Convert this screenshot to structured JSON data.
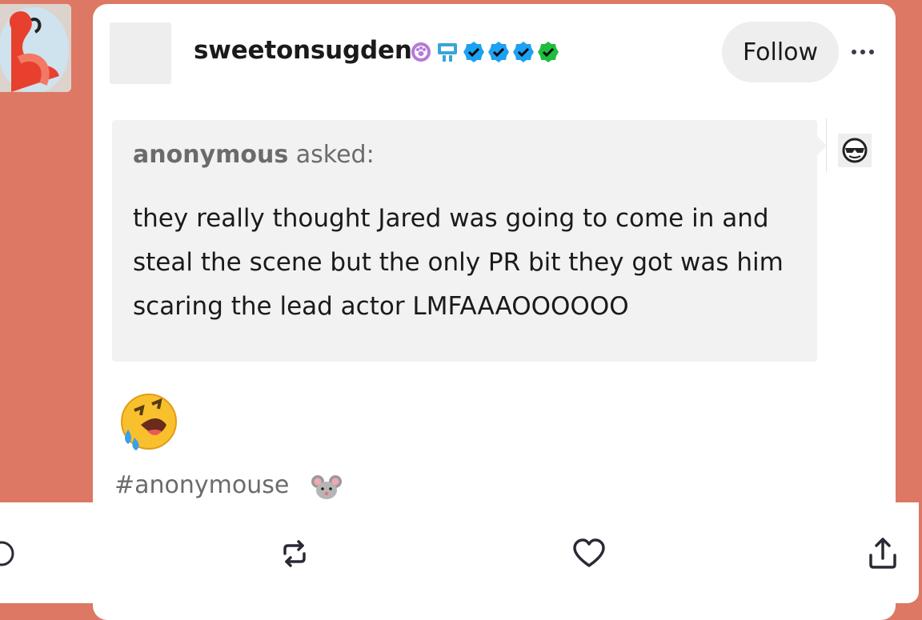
{
  "post": {
    "blog_name": "sweetonsugden",
    "follow_label": "Follow",
    "ask": {
      "asker": "anonymous",
      "asked_label": "asked:",
      "question": "they really thought Jared was going to come in and steal the scene but the only PR bit they got was him scaring the lead actor LMFAAAOOOOOO"
    },
    "reply_emoji": "rolling-on-floor-laughing",
    "tag": "#anonymouse",
    "tag_emoji": "mouse-face"
  },
  "badges": [
    "paw-badge",
    "robot-badge",
    "verified-blue-badge",
    "verified-blue-badge",
    "verified-blue-badge",
    "verified-green-badge"
  ],
  "actions": [
    "reply-icon",
    "reblog-icon",
    "like-icon",
    "share-icon"
  ],
  "colors": {
    "page_background": "#dc7864",
    "card": "#ffffff",
    "ask_background": "#f2f2f2",
    "verified_blue": "#1da1f2",
    "verified_green": "#1ebd3c",
    "icon": "#1a1a1a"
  }
}
